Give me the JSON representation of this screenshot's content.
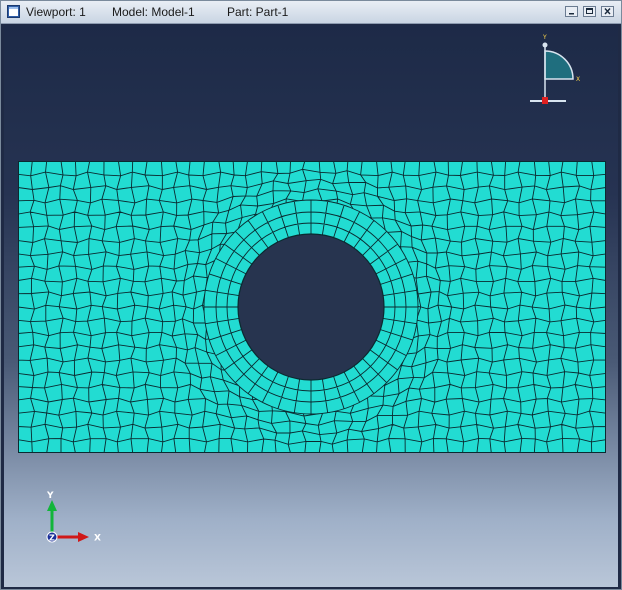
{
  "window": {
    "viewport_label": "Viewport: 1",
    "model_label": "Model: Model-1",
    "part_label": "Part: Part-1"
  },
  "triad_bottom": {
    "y_label": "Y",
    "x_label": "X",
    "z_label": "Z"
  },
  "triad_top": {
    "y_label": "Y",
    "x_label": "X"
  },
  "colors": {
    "mesh_fill": "#22dcd2",
    "mesh_line": "#0a2a30",
    "hole_fill": "#27344f"
  },
  "icons": [
    "viewport-icon",
    "minimize-icon",
    "maximize-icon",
    "close-icon"
  ]
}
